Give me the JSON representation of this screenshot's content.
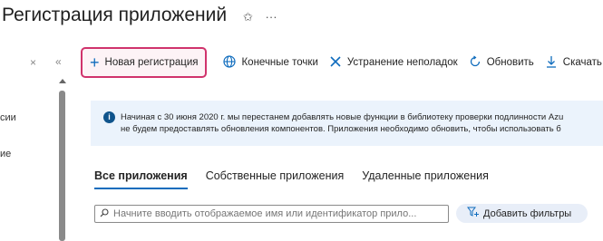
{
  "page_title": "Регистрация приложений",
  "title_actions": {
    "pin_glyph": "✩",
    "more_glyph": "···"
  },
  "left_pane": {
    "close_glyph": "×",
    "collapse_glyph": "«",
    "items": [
      "сии",
      "ие"
    ]
  },
  "toolbar": {
    "new_registration": "Новая регистрация",
    "endpoints": "Конечные точки",
    "troubleshoot": "Устранение неполадок",
    "refresh": "Обновить",
    "download": "Скачать"
  },
  "banner": {
    "line1": "Начиная с 30 июня 2020 г. мы перестанем добавлять новые функции в библиотеку проверки подлинности Azu",
    "line2": "не будем предоставлять обновления компонентов. Приложения необходимо обновить, чтобы использовать б"
  },
  "tabs": [
    {
      "label": "Все приложения",
      "active": true
    },
    {
      "label": "Собственные приложения",
      "active": false
    },
    {
      "label": "Удаленные приложения",
      "active": false
    }
  ],
  "search": {
    "placeholder": "Начните вводить отображаемое имя или идентификатор прило..."
  },
  "filter_button": "Добавить фильтры",
  "colors": {
    "accent": "#0f6cbd",
    "highlight_border": "#d0336c",
    "banner_bg": "#ebf3fc"
  }
}
